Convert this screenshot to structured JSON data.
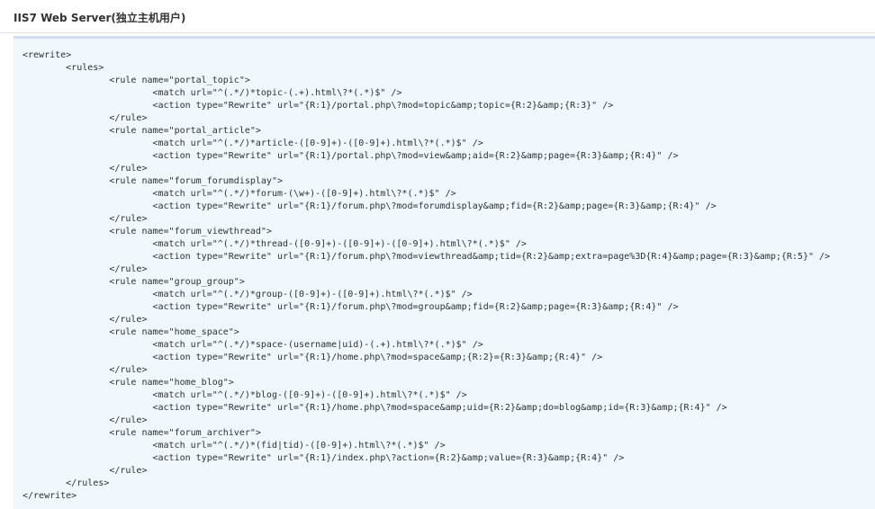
{
  "header": {
    "title": "IIS7 Web Server(独立主机用户)"
  },
  "code": {
    "lines": [
      "<rewrite>",
      "\t<rules>",
      "\t\t<rule name=\"portal_topic\">",
      "\t\t\t<match url=\"^(.*/)*topic-(.+).html\\?*(.*)$\" />",
      "\t\t\t<action type=\"Rewrite\" url=\"{R:1}/portal.php\\?mod=topic&amp;topic={R:2}&amp;{R:3}\" />",
      "\t\t</rule>",
      "\t\t<rule name=\"portal_article\">",
      "\t\t\t<match url=\"^(.*/)*article-([0-9]+)-([0-9]+).html\\?*(.*)$\" />",
      "\t\t\t<action type=\"Rewrite\" url=\"{R:1}/portal.php\\?mod=view&amp;aid={R:2}&amp;page={R:3}&amp;{R:4}\" />",
      "\t\t</rule>",
      "\t\t<rule name=\"forum_forumdisplay\">",
      "\t\t\t<match url=\"^(.*/)*forum-(\\w+)-([0-9]+).html\\?*(.*)$\" />",
      "\t\t\t<action type=\"Rewrite\" url=\"{R:1}/forum.php\\?mod=forumdisplay&amp;fid={R:2}&amp;page={R:3}&amp;{R:4}\" />",
      "\t\t</rule>",
      "\t\t<rule name=\"forum_viewthread\">",
      "\t\t\t<match url=\"^(.*/)*thread-([0-9]+)-([0-9]+)-([0-9]+).html\\?*(.*)$\" />",
      "\t\t\t<action type=\"Rewrite\" url=\"{R:1}/forum.php\\?mod=viewthread&amp;tid={R:2}&amp;extra=page%3D{R:4}&amp;page={R:3}&amp;{R:5}\" />",
      "\t\t</rule>",
      "\t\t<rule name=\"group_group\">",
      "\t\t\t<match url=\"^(.*/)*group-([0-9]+)-([0-9]+).html\\?*(.*)$\" />",
      "\t\t\t<action type=\"Rewrite\" url=\"{R:1}/forum.php\\?mod=group&amp;fid={R:2}&amp;page={R:3}&amp;{R:4}\" />",
      "\t\t</rule>",
      "\t\t<rule name=\"home_space\">",
      "\t\t\t<match url=\"^(.*/)*space-(username|uid)-(.+).html\\?*(.*)$\" />",
      "\t\t\t<action type=\"Rewrite\" url=\"{R:1}/home.php\\?mod=space&amp;{R:2}={R:3}&amp;{R:4}\" />",
      "\t\t</rule>",
      "\t\t<rule name=\"home_blog\">",
      "\t\t\t<match url=\"^(.*/)*blog-([0-9]+)-([0-9]+).html\\?*(.*)$\" />",
      "\t\t\t<action type=\"Rewrite\" url=\"{R:1}/home.php\\?mod=space&amp;uid={R:2}&amp;do=blog&amp;id={R:3}&amp;{R:4}\" />",
      "\t\t</rule>",
      "\t\t<rule name=\"forum_archiver\">",
      "\t\t\t<match url=\"^(.*/)*(fid|tid)-([0-9]+).html\\?*(.*)$\" />",
      "\t\t\t<action type=\"Rewrite\" url=\"{R:1}/index.php\\?action={R:2}&amp;value={R:3}&amp;{R:4}\" />",
      "\t\t</rule>",
      "\t</rules>",
      "</rewrite>"
    ]
  }
}
